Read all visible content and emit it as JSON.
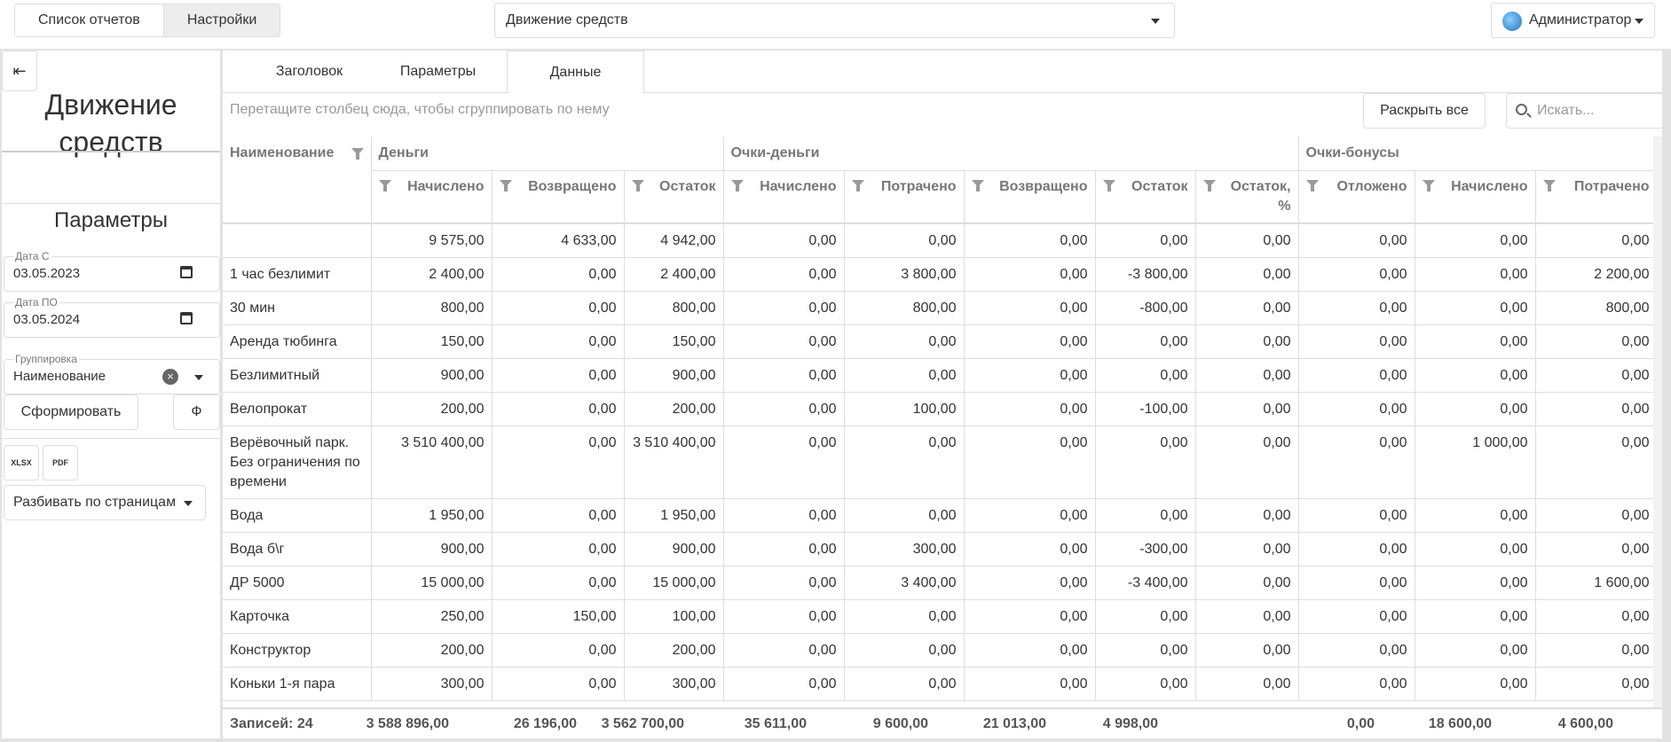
{
  "topbar": {
    "nav": [
      "Список отчетов",
      "Настройки"
    ],
    "report_select": "Движение средств",
    "user": "Администратор"
  },
  "sidebar": {
    "title": "Движение средств",
    "params_title": "Параметры",
    "date_from": {
      "label": "Дата С",
      "value": "03.05.2023"
    },
    "date_to": {
      "label": "Дата ПО",
      "value": "03.05.2024"
    },
    "grouping": {
      "label": "Группировка",
      "value": "Наименование"
    },
    "form_button": "Сформировать",
    "f_button": "Ф",
    "export_xlsx": "XLSX",
    "export_pdf": "PDF",
    "paging": "Разбивать по страницам"
  },
  "tabs": [
    "Заголовок",
    "Параметры",
    "Данные"
  ],
  "grid": {
    "group_hint": "Перетащите столбец сюда, чтобы сгруппировать по нему",
    "expand_all": "Раскрыть все",
    "search_placeholder": "Искать...",
    "bands": [
      "Наименование",
      "Деньги",
      "Очки-деньги",
      "Очки-бонусы"
    ],
    "columns": [
      "Начислено",
      "Возвращено",
      "Остаток",
      "Начислено",
      "Потрачено",
      "Возвращено",
      "Остаток",
      "Остаток, %",
      "Отложено",
      "Начислено",
      "Потрачено"
    ],
    "rows": [
      [
        "",
        "9 575,00",
        "4 633,00",
        "4 942,00",
        "0,00",
        "0,00",
        "0,00",
        "0,00",
        "0,00",
        "0,00",
        "0,00",
        "0,00"
      ],
      [
        "1 час безлимит",
        "2 400,00",
        "0,00",
        "2 400,00",
        "0,00",
        "3 800,00",
        "0,00",
        "-3 800,00",
        "0,00",
        "0,00",
        "0,00",
        "2 200,00"
      ],
      [
        "30 мин",
        "800,00",
        "0,00",
        "800,00",
        "0,00",
        "800,00",
        "0,00",
        "-800,00",
        "0,00",
        "0,00",
        "0,00",
        "800,00"
      ],
      [
        "Аренда тюбинга",
        "150,00",
        "0,00",
        "150,00",
        "0,00",
        "0,00",
        "0,00",
        "0,00",
        "0,00",
        "0,00",
        "0,00",
        "0,00"
      ],
      [
        "Безлимитный",
        "900,00",
        "0,00",
        "900,00",
        "0,00",
        "0,00",
        "0,00",
        "0,00",
        "0,00",
        "0,00",
        "0,00",
        "0,00"
      ],
      [
        "Велопрокат",
        "200,00",
        "0,00",
        "200,00",
        "0,00",
        "100,00",
        "0,00",
        "-100,00",
        "0,00",
        "0,00",
        "0,00",
        "0,00"
      ],
      [
        "Верёвочный парк. Без ограничения по времени",
        "3 510 400,00",
        "0,00",
        "3 510 400,00",
        "0,00",
        "0,00",
        "0,00",
        "0,00",
        "0,00",
        "0,00",
        "1 000,00",
        "0,00"
      ],
      [
        "Вода",
        "1 950,00",
        "0,00",
        "1 950,00",
        "0,00",
        "0,00",
        "0,00",
        "0,00",
        "0,00",
        "0,00",
        "0,00",
        "0,00"
      ],
      [
        "Вода б\\г",
        "900,00",
        "0,00",
        "900,00",
        "0,00",
        "300,00",
        "0,00",
        "-300,00",
        "0,00",
        "0,00",
        "0,00",
        "0,00"
      ],
      [
        "ДР 5000",
        "15 000,00",
        "0,00",
        "15 000,00",
        "0,00",
        "3 400,00",
        "0,00",
        "-3 400,00",
        "0,00",
        "0,00",
        "0,00",
        "1 600,00"
      ],
      [
        "Карточка",
        "250,00",
        "150,00",
        "100,00",
        "0,00",
        "0,00",
        "0,00",
        "0,00",
        "0,00",
        "0,00",
        "0,00",
        "0,00"
      ],
      [
        "Конструктор",
        "200,00",
        "0,00",
        "200,00",
        "0,00",
        "0,00",
        "0,00",
        "0,00",
        "0,00",
        "0,00",
        "0,00",
        "0,00"
      ],
      [
        "Коньки 1-я пара",
        "300,00",
        "0,00",
        "300,00",
        "0,00",
        "0,00",
        "0,00",
        "0,00",
        "0,00",
        "0,00",
        "0,00",
        "0,00"
      ]
    ],
    "footer": [
      "Записей: 24",
      "3 588 896,00",
      "26 196,00",
      "3 562 700,00",
      "35 611,00",
      "9 600,00",
      "21 013,00",
      "4 998,00",
      "",
      "0,00",
      "18 600,00",
      "4 600,00"
    ]
  }
}
